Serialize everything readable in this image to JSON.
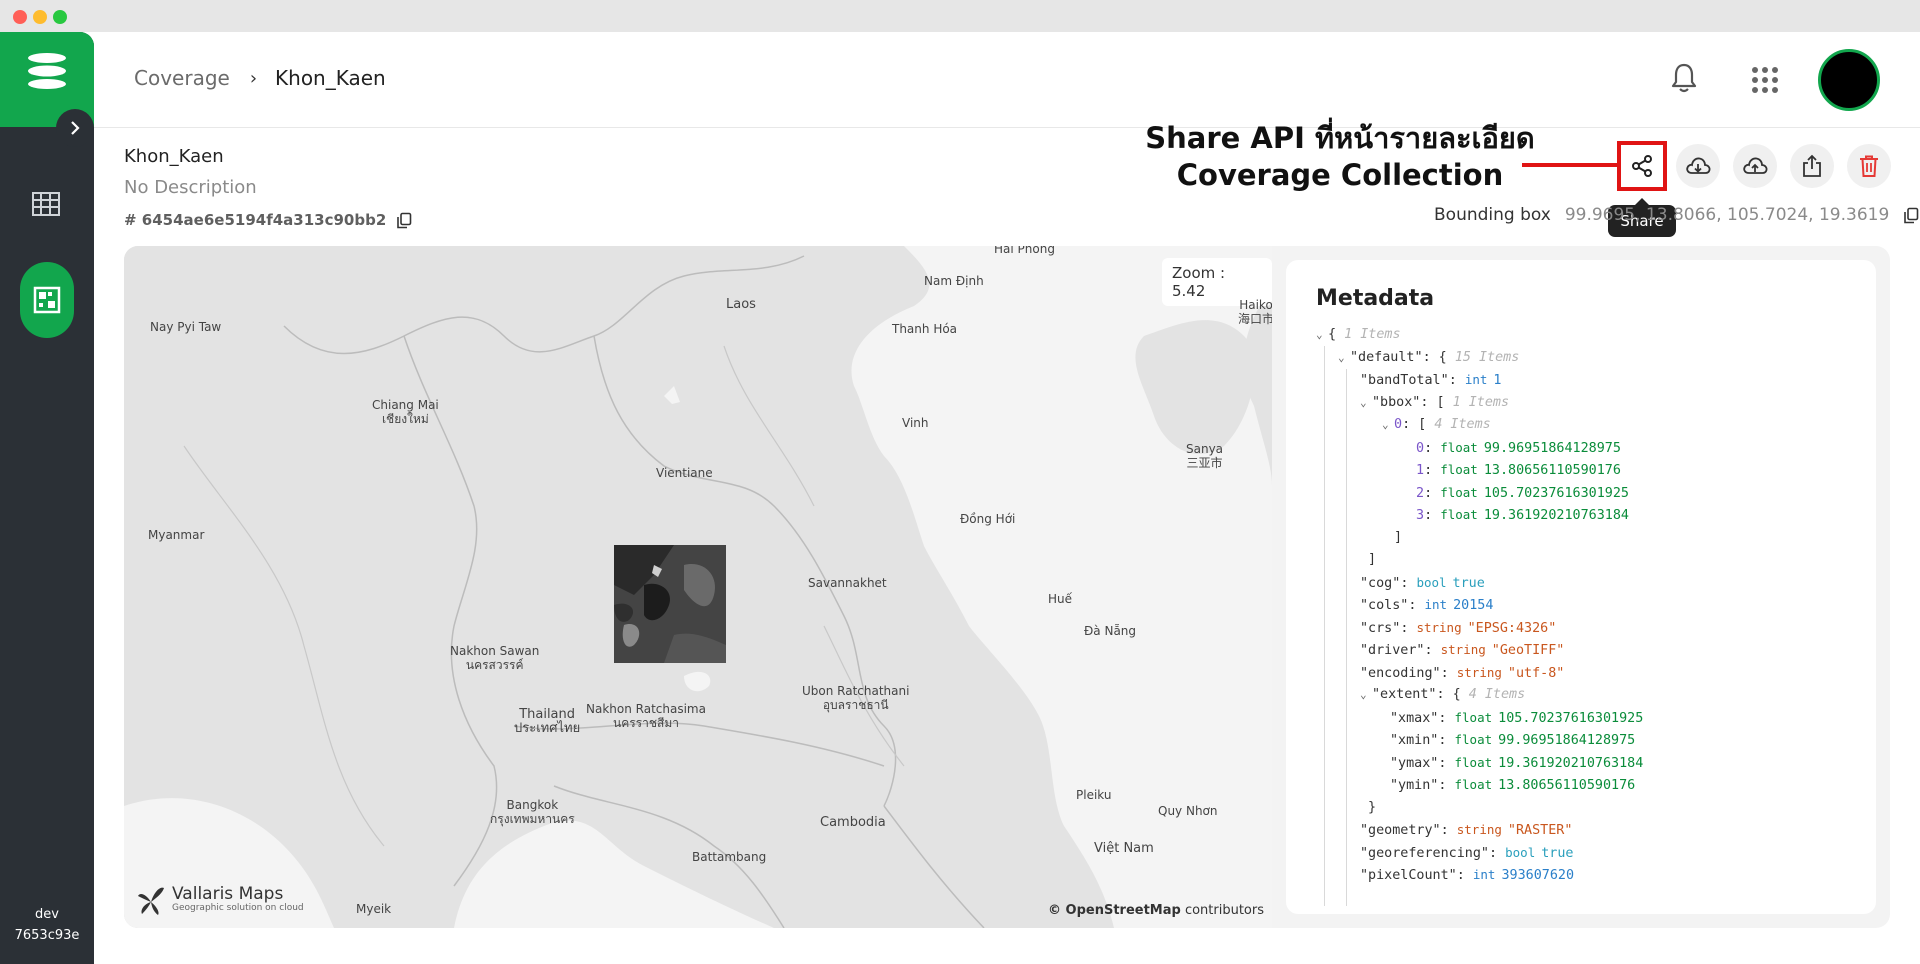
{
  "breadcrumb": {
    "parent": "Coverage",
    "current": "Khon_Kaen"
  },
  "sidebar": {
    "env_name": "dev",
    "env_hash": "7653c93e"
  },
  "info": {
    "name": "Khon_Kaen",
    "description": "No Description",
    "id": "# 6454ae6e5194f4a313c90bb2"
  },
  "annotation": {
    "line1": "Share API ที่หน้ารายละเอียด",
    "line2": "Coverage Collection"
  },
  "tooltip": {
    "share": "Share"
  },
  "bbox": {
    "label": "Bounding box",
    "value": "99.9695, 13.8066, 105.7024, 19.3619"
  },
  "map": {
    "zoom": "Zoom : 5.42",
    "attribution_bold": "© OpenStreetMap",
    "attribution_rest": " contributors",
    "brand": "Vallaris Maps",
    "brand_sub": "Geographic solution on cloud",
    "labels": {
      "hai_phong": "Hải Phòng",
      "nam_dinh": "Nam Định",
      "laos": "Laos",
      "haikou": "Haiko",
      "haikou_cn": "海口市",
      "nay_pyi_taw": "Nay Pyi Taw",
      "thanh_hoa": "Thanh Hóa",
      "chiang_mai": "Chiang Mai",
      "chiang_mai_th": "เชียงใหม่",
      "vinh": "Vinh",
      "sanya": "Sanya",
      "sanya_cn": "三亚市",
      "vientiane": "Vientiane",
      "myanmar": "Myanmar",
      "dong_hoi": "Đồng Hới",
      "savannakhet": "Savannakhet",
      "hue": "Huế",
      "da_nang": "Đà Nẵng",
      "nakhon_sawan": "Nakhon Sawan",
      "nakhon_sawan_th": "นครสวรรค์",
      "ubon": "Ubon Ratchathani",
      "ubon_th": "อุบลราชธานี",
      "thailand": "Thailand",
      "thailand_th": "ประเทศไทย",
      "nakhon_ratchasima": "Nakhon Ratchasima",
      "nakhon_ratchasima_th": "นครราชสีมา",
      "bangkok": "Bangkok",
      "bangkok_th": "กรุงเทพมหานคร",
      "cambodia": "Cambodia",
      "pleiku": "Pleiku",
      "quy_nhon": "Quy Nhơn",
      "viet_nam": "Việt Nam",
      "battambang": "Battambang",
      "myeik": "Myeik"
    }
  },
  "metadata": {
    "title": "Metadata",
    "root_open": "{",
    "root_count": "1 Items",
    "default_key": "\"default\"",
    "default_count": "15 Items",
    "bandTotal_key": "\"bandTotal\"",
    "bandTotal_type": "int",
    "bandTotal_val": "1",
    "bbox_key": "\"bbox\"",
    "bbox_count": "1 Items",
    "bbox0_key": "0",
    "bbox0_count": "4 Items",
    "b0": "99.96951864128975",
    "b1": "13.80656110590176",
    "b2": "105.70237616301925",
    "b3": "19.361920210763184",
    "cog_key": "\"cog\"",
    "cog_type": "bool",
    "cog_val": "true",
    "cols_key": "\"cols\"",
    "cols_type": "int",
    "cols_val": "20154",
    "crs_key": "\"crs\"",
    "crs_type": "string",
    "crs_val": "\"EPSG:4326\"",
    "driver_key": "\"driver\"",
    "driver_type": "string",
    "driver_val": "\"GeoTIFF\"",
    "encoding_key": "\"encoding\"",
    "encoding_type": "string",
    "encoding_val": "\"utf-8\"",
    "extent_key": "\"extent\"",
    "extent_count": "4 Items",
    "xmax_key": "\"xmax\"",
    "xmax_val": "105.70237616301925",
    "xmin_key": "\"xmin\"",
    "xmin_val": "99.96951864128975",
    "ymax_key": "\"ymax\"",
    "ymax_val": "19.361920210763184",
    "ymin_key": "\"ymin\"",
    "ymin_val": "13.80656110590176",
    "geometry_key": "\"geometry\"",
    "geometry_type": "string",
    "geometry_val": "\"RASTER\"",
    "georef_key": "\"georeferencing\"",
    "georef_type": "bool",
    "georef_val": "true",
    "pixelCount_key": "\"pixelCount\"",
    "pixelCount_type": "int",
    "pixelCount_val": "393607620",
    "float_type": "float",
    "idx0": "0",
    "idx1": "1",
    "idx2": "2",
    "idx3": "3"
  },
  "colors": {
    "brand_green": "#12a64d",
    "sidebar_dark": "#2b3036",
    "annotation_red": "#e01414",
    "delete_red": "#e53935"
  },
  "icons": [
    "menu-logo-icon",
    "chevron-right-icon",
    "grid-table-icon",
    "mosaic-icon",
    "bell-icon",
    "apps-grid-icon",
    "copy-icon",
    "share-icon",
    "cloud-download-icon",
    "cloud-upload-icon",
    "export-icon",
    "trash-icon",
    "vallaris-logo-icon"
  ]
}
